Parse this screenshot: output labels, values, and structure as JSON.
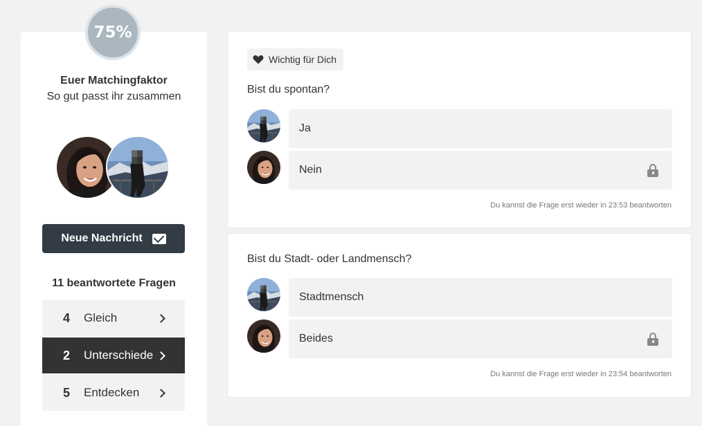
{
  "match": {
    "percent": "75%",
    "title": "Euer Matchingfaktor",
    "subtitle": "So gut passt ihr zusammen"
  },
  "new_message_label": "Neue Nachricht",
  "answered_label": "11 beantwortete Fragen",
  "filters": [
    {
      "count": "4",
      "label": "Gleich",
      "active": false
    },
    {
      "count": "2",
      "label": "Unterschiede",
      "active": true
    },
    {
      "count": "5",
      "label": "Entdecken",
      "active": false
    }
  ],
  "questions": [
    {
      "tag": "Wichtig für Dich",
      "question": "Bist du spontan?",
      "answers": [
        {
          "user": "other",
          "text": "Ja",
          "locked": false
        },
        {
          "user": "self",
          "text": "Nein",
          "locked": true
        }
      ],
      "note": "Du kannst die Frage erst wieder in 23:53 beantworten"
    },
    {
      "question": "Bist du Stadt- oder Landmensch?",
      "answers": [
        {
          "user": "other",
          "text": "Stadtmensch",
          "locked": false
        },
        {
          "user": "self",
          "text": "Beides",
          "locked": true
        }
      ],
      "note": "Du kannst die Frage erst wieder in 23:54 beantworten"
    }
  ],
  "colors": {
    "dark_button": "#333c45",
    "active_filter": "#333333",
    "badge": "#aab7c0",
    "panel": "#f2f2f2"
  }
}
